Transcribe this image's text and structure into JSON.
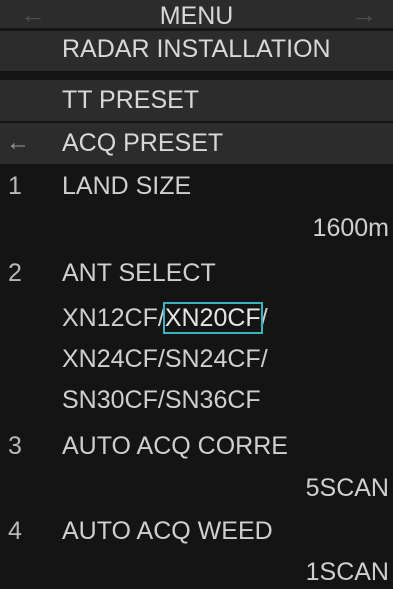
{
  "header": {
    "title": "MENU",
    "left_arrow_icon": "arrow-left-icon",
    "right_arrow_icon": "arrow-right-icon"
  },
  "breadcrumb": {
    "radar_installation": "RADAR INSTALLATION",
    "tt_preset": "TT PRESET",
    "acq_preset": "ACQ PRESET",
    "back_icon": "back-arrow-icon",
    "back_glyph": "←"
  },
  "items": [
    {
      "number": "1",
      "label": "LAND SIZE",
      "value": "1600m"
    },
    {
      "number": "2",
      "label": "ANT SELECT",
      "options": [
        "XN12CF",
        "XN20CF",
        "XN24CF",
        "SN24CF",
        "SN30CF",
        "SN36CF"
      ],
      "separator": "/",
      "selected": "XN20CF"
    },
    {
      "number": "3",
      "label": "AUTO ACQ CORRE",
      "value": "5SCAN"
    },
    {
      "number": "4",
      "label": "AUTO ACQ WEED",
      "value": "1SCAN"
    }
  ],
  "colors": {
    "background": "#141414",
    "row_background": "#2c2c2c",
    "text": "#d2d2d2",
    "selection_outline": "#3ab2bf"
  }
}
